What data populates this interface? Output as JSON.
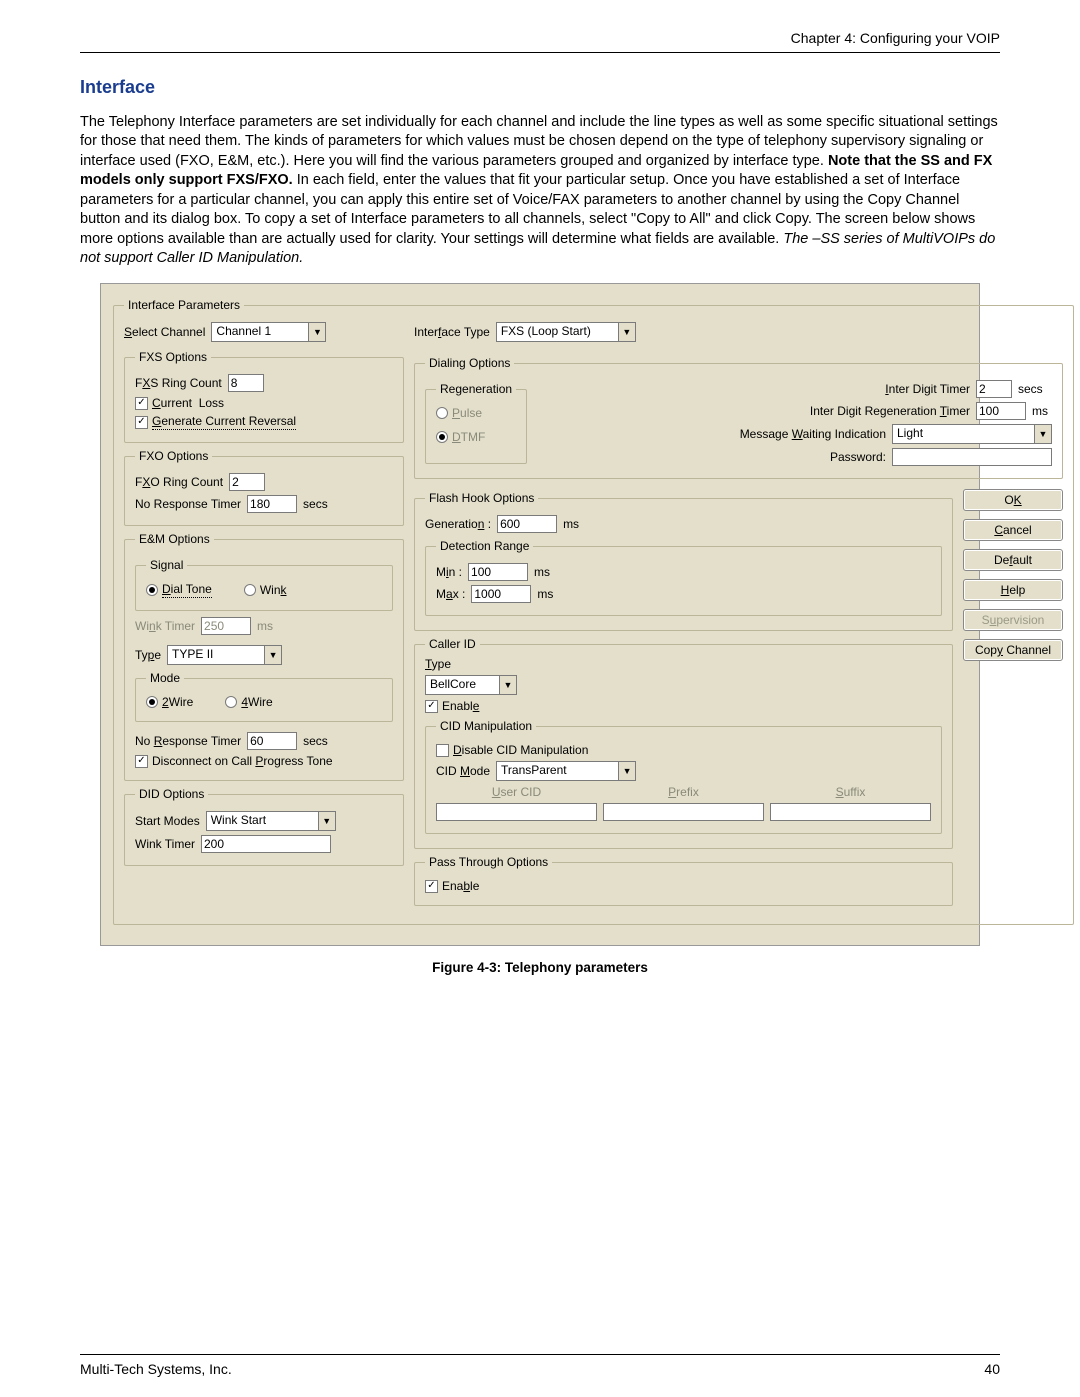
{
  "header": {
    "chapter": "Chapter 4: Configuring your VOIP"
  },
  "section": {
    "title": "Interface",
    "para_pre": "The Telephony Interface parameters are set individually for each channel and include the line types as well as some specific situational settings for those that need them. The kinds of parameters for which values must be chosen depend on the type of telephony supervisory signaling or interface used (FXO, E&M, etc.). Here you will find the various parameters grouped and organized by interface type. ",
    "para_bold": "Note that the SS and FX models only support FXS/FXO.",
    "para_post": " In each field, enter the values that fit your particular setup. Once you have established a set of Interface parameters for a particular channel, you can apply this entire set of Voice/FAX parameters to another channel by using the Copy Channel button and its dialog box. To copy a set of Interface parameters to all channels, select \"Copy to All\" and click Copy. The screen below shows more options available than are actually used for clarity. Your settings will determine what fields are available. ",
    "para_italic": "The –SS series of MultiVOIPs do not support Caller ID Manipulation."
  },
  "dialog": {
    "title": "Interface Parameters",
    "select_channel_label": "Select Channel",
    "select_channel_value": "Channel 1",
    "interface_type_label": "Interface Type",
    "interface_type_value": "FXS (Loop Start)",
    "fxs": {
      "legend": "FXS Options",
      "ring_count_label": "FXS Ring Count",
      "ring_count_value": "8",
      "current_loss_label": "Current  Loss",
      "current_loss_checked": true,
      "gen_reversal_label": "Generate Current Reversal",
      "gen_reversal_checked": true
    },
    "fxo": {
      "legend": "FXO Options",
      "ring_count_label": "FXO Ring Count",
      "ring_count_value": "2",
      "no_response_label": "No Response Timer",
      "no_response_value": "180",
      "no_response_unit": "secs"
    },
    "em": {
      "legend": "E&M Options",
      "signal_legend": "Signal",
      "dial_tone_label": "Dial Tone",
      "wink_label": "Wink",
      "wink_timer_label": "Wink Timer",
      "wink_timer_value": "250",
      "wink_timer_unit": "ms",
      "type_label": "Type",
      "type_value": "TYPE II",
      "mode_legend": "Mode",
      "two_wire_label": "2Wire",
      "four_wire_label": "4Wire",
      "no_response_label": "No Response Timer",
      "no_response_value": "60",
      "no_response_unit": "secs",
      "disconnect_label": "Disconnect on Call Progress Tone",
      "disconnect_checked": true
    },
    "did": {
      "legend": "DID Options",
      "start_modes_label": "Start Modes",
      "start_modes_value": "Wink Start",
      "wink_timer_label": "Wink Timer",
      "wink_timer_value": "200"
    },
    "dialing": {
      "legend": "Dialing Options",
      "regen_legend": "Regeneration",
      "pulse_label": "Pulse",
      "dtmf_label": "DTMF",
      "idt_label": "Inter Digit Timer",
      "idt_value": "2",
      "idt_unit": "secs",
      "idrt_label": "Inter Digit Regeneration Timer",
      "idrt_value": "100",
      "idrt_unit": "ms",
      "mwi_label": "Message Waiting Indication",
      "mwi_value": "Light",
      "password_label": "Password:",
      "password_value": ""
    },
    "flash": {
      "legend": "Flash Hook Options",
      "gen_label": "Generation :",
      "gen_value": "600",
      "gen_unit": "ms",
      "range_legend": "Detection Range",
      "min_label": "Min :",
      "min_value": "100",
      "max_label": "Max :",
      "max_value": "1000",
      "range_unit": "ms"
    },
    "cid": {
      "legend": "Caller ID",
      "type_label": "Type",
      "type_value": "BellCore",
      "enable_label": "Enable",
      "enable_checked": true,
      "manip_legend": "CID Manipulation",
      "disable_label": "Disable CID Manipulation",
      "disable_checked": false,
      "mode_label": "CID Mode",
      "mode_value": "TransParent",
      "usercid_label": "User CID",
      "prefix_label": "Prefix",
      "suffix_label": "Suffix"
    },
    "pto": {
      "legend": "Pass Through Options",
      "enable_label": "Enable",
      "enable_checked": true
    },
    "buttons": {
      "ok": "OK",
      "cancel": "Cancel",
      "default": "Default",
      "help": "Help",
      "supervision": "Supervision",
      "copy_channel": "Copy Channel"
    }
  },
  "caption": "Figure 4-3: Telephony parameters",
  "footer": {
    "left": "Multi-Tech Systems, Inc.",
    "right": "40"
  }
}
